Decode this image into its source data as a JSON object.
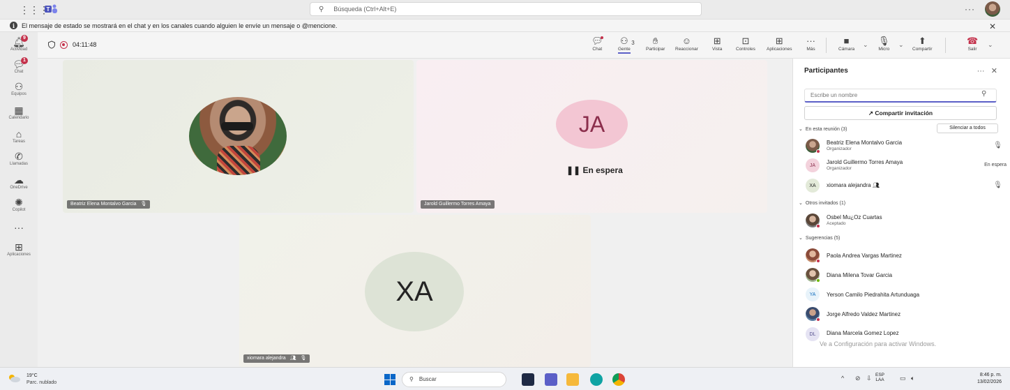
{
  "titlebar": {
    "search_placeholder": "Búsqueda (Ctrl+Alt+E)",
    "more": "···"
  },
  "banner": {
    "message": "El mensaje de estado se mostrará en el chat y en los canales cuando alguien le envíe un mensaje o @mencione.",
    "close": "✕"
  },
  "rail": {
    "items": [
      {
        "label": "Actividad",
        "icon": "bell-icon",
        "badge": "9"
      },
      {
        "label": "Chat",
        "icon": "chat-icon",
        "badge": "1"
      },
      {
        "label": "Equipos",
        "icon": "teams-icon"
      },
      {
        "label": "Calendario",
        "icon": "calendar-icon"
      },
      {
        "label": "Tareas",
        "icon": "tasks-icon"
      },
      {
        "label": "Llamadas",
        "icon": "phone-icon"
      },
      {
        "label": "OneDrive",
        "icon": "cloud-icon"
      },
      {
        "label": "Copilot",
        "icon": "copilot-icon"
      },
      {
        "label": "···",
        "icon": "more-icon"
      },
      {
        "label": "Aplicaciones",
        "icon": "apps-icon"
      }
    ]
  },
  "meeting": {
    "elapsed": "04:11:48",
    "tools": {
      "chat": "Chat",
      "people": "Gente",
      "people_count": "3",
      "raise": "Participar",
      "react": "Reaccionar",
      "view": "Vista",
      "controls": "Controles",
      "apps": "Aplicaciones",
      "more": "Más",
      "camera": "Cámara",
      "mic": "Micro",
      "share": "Compartir",
      "leave": "Salir"
    }
  },
  "stage": {
    "tile1": {
      "name": "Beatriz Elena Montalvo Garcia"
    },
    "tile2": {
      "initials": "JA",
      "status": "En espera",
      "name": "Jarold Guillermo Torres Amaya"
    },
    "tile3": {
      "initials": "XA",
      "name": "xiomara alejandra"
    }
  },
  "panel": {
    "title": "Participantes",
    "more": "···",
    "close": "✕",
    "search_placeholder": "Escribe un nombre",
    "invite": "Compartir invitación",
    "in_meeting": "En esta reunión (3)",
    "silence_all": "Silenciar a todos",
    "others": "Otros invitados (1)",
    "suggestions": "Sugerencias (5)",
    "members": [
      {
        "name": "Beatriz Elena Montalvo Garcia",
        "role": "Organizador"
      },
      {
        "name": "Jarold Guillermo Torres Amaya",
        "role": "Organizador",
        "initials": "JA",
        "status": "En espera"
      },
      {
        "name": "xiomara alejandra",
        "initials": "XA"
      }
    ],
    "invited": [
      {
        "name": "Osbel Mu¿Oz Cuartas",
        "role": "Aceptado"
      }
    ],
    "suggested": [
      {
        "name": "Paola Andrea Vargas Martinez"
      },
      {
        "name": "Diana Milena Tovar Garcia"
      },
      {
        "name": "Yerson Camilo Piedrahita Artunduaga",
        "initials": "YA"
      },
      {
        "name": "Jorge Alfredo Valdez Martinez"
      },
      {
        "name": "Diana Marcela Gomez Lopez",
        "initials": "DL"
      }
    ],
    "watermark": "Ve a Configuración para activar Windows."
  },
  "taskbar": {
    "temp": "19°C",
    "weather": "Parc. nublado",
    "search": "Buscar",
    "lang": "ESP",
    "lang2": "LAA",
    "time": "8:46 p. m.",
    "date": "13/02/2026"
  },
  "colors": {
    "accent": "#5b5fc7",
    "alert": "#c4314b",
    "leave": "#c4314b"
  }
}
